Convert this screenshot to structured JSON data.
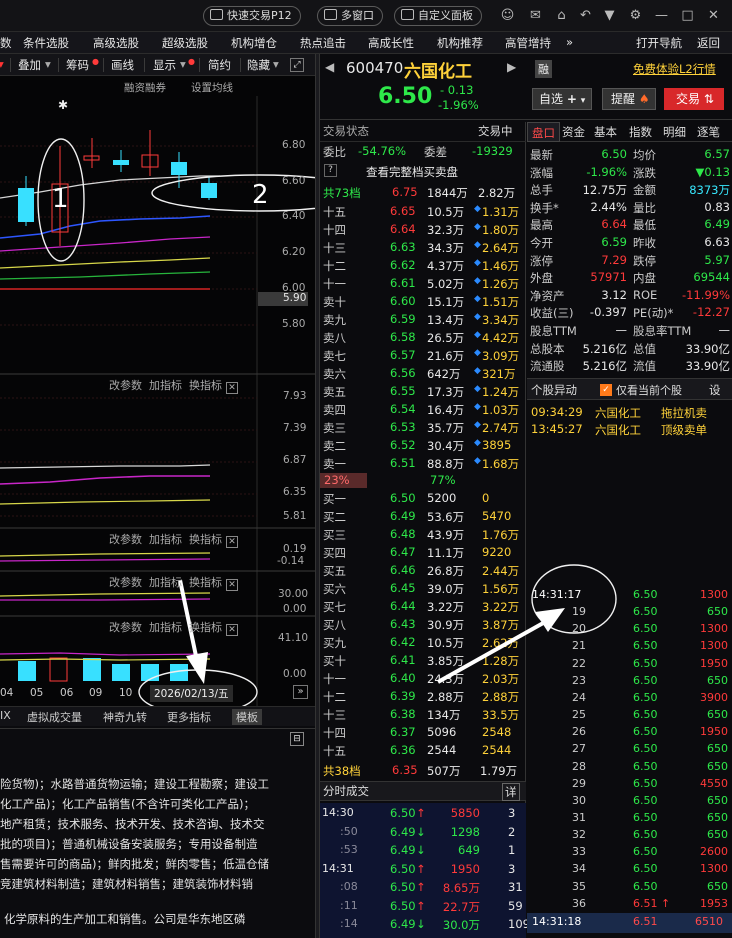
{
  "titlebar": {
    "quick_trade": "快速交易P12",
    "multi_window": "多窗口",
    "custom_panel": "自定义面板"
  },
  "menubar": [
    "数",
    "条件选股",
    "高级选股",
    "超级选股",
    "机构增仓",
    "热点追击",
    "高成长性",
    "机构推荐",
    "高管增持",
    "»",
    "打开导航",
    "返回"
  ],
  "toolbar": {
    "items": [
      "叠加",
      "筹码",
      "画线",
      "显示",
      "简约",
      "隐藏"
    ]
  },
  "chart": {
    "header": [
      "融资融券",
      "设置均线"
    ],
    "price_ticks": [
      "6.80",
      "6.60",
      "6.40",
      "6.20",
      "6.00",
      "5.80"
    ],
    "current_price_tag": "5.90",
    "annot1": "1",
    "annot2": "2",
    "sub_panels": [
      {
        "links": [
          "改参数",
          "加指标",
          "换指标"
        ],
        "ticks": [
          "7.93",
          "7.39",
          "6.87",
          "6.35",
          "5.81"
        ]
      },
      {
        "links": [
          "改参数",
          "加指标",
          "换指标"
        ],
        "ticks": [
          "0.19",
          "-0.14"
        ]
      },
      {
        "links": [
          "改参数",
          "加指标",
          "换指标"
        ],
        "ticks": [
          "30.00",
          "0.00"
        ]
      },
      {
        "links": [
          "改参数",
          "加指标",
          "换指标"
        ],
        "ticks": [
          "41.10",
          "0.00"
        ]
      }
    ],
    "dates": [
      "04",
      "05",
      "06",
      "09",
      "10"
    ],
    "date_cursor": "2026/02/13/五"
  },
  "bottomtabs": [
    "IX",
    "虚拟成交量",
    "神奇九转",
    "更多指标",
    "模板"
  ],
  "info_lines": [
    "险货物)；水路普通货物运输；建设工程勘察；建设工",
    "化工产品)；化工产品销售(不含许可类化工产品)；",
    "地产租赁；技术服务、技术开发、技术咨询、技术交",
    "批的项目)；普通机械设备安装服务；专用设备制造",
    "售需要许可的商品)；鲜肉批发；鲜肉零售；低温仓储",
    "竞建筑材料制造；建筑材料销售；建筑装饰材料销",
    "化学原料的生产加工和销售。公司是华东地区磷"
  ],
  "quote": {
    "code": "600470",
    "name": "六国化工",
    "rong": "融",
    "l2": "免费体验L2行情",
    "price": "6.50",
    "change": "- 0.13",
    "pct": "-1.96%",
    "btn_select": "自选",
    "btn_alert": "提醒",
    "btn_trade": "交易"
  },
  "book": {
    "tabs": [
      "交易状态",
      "交易中"
    ],
    "weibi_label": "委比",
    "weibi": "-54.76%",
    "weicha_label": "委差",
    "weicha": "-19329",
    "view_full": "查看完整档买卖盘",
    "sell_total": {
      "label": "共73档",
      "price": "6.75",
      "vol": "1844万",
      "amt": "2.82万"
    },
    "sells": [
      [
        "十五",
        "6.65",
        "10.5万",
        "1.31万"
      ],
      [
        "十四",
        "6.64",
        "32.3万",
        "1.80万"
      ],
      [
        "十三",
        "6.63",
        "34.3万",
        "2.64万"
      ],
      [
        "十二",
        "6.62",
        "4.37万",
        "1.46万"
      ],
      [
        "十一",
        "6.61",
        "5.02万",
        "1.26万"
      ],
      [
        "卖十",
        "6.60",
        "15.1万",
        "1.51万"
      ],
      [
        "卖九",
        "6.59",
        "13.4万",
        "3.34万"
      ],
      [
        "卖八",
        "6.58",
        "26.5万",
        "4.42万"
      ],
      [
        "卖七",
        "6.57",
        "21.6万",
        "3.09万"
      ],
      [
        "卖六",
        "6.56",
        "642万",
        "321万"
      ],
      [
        "卖五",
        "6.55",
        "17.3万",
        "1.24万"
      ],
      [
        "卖四",
        "6.54",
        "16.4万",
        "1.03万"
      ],
      [
        "卖三",
        "6.53",
        "35.7万",
        "2.74万"
      ],
      [
        "卖二",
        "6.52",
        "30.4万",
        "3895"
      ],
      [
        "卖一",
        "6.51",
        "88.8万",
        "1.68万"
      ]
    ],
    "ratio": {
      "buy": "23%",
      "sell": "77%",
      "buy_frac": 0.23
    },
    "buys": [
      [
        "买一",
        "6.50",
        "5200",
        "0"
      ],
      [
        "买二",
        "6.49",
        "53.6万",
        "5470"
      ],
      [
        "买三",
        "6.48",
        "43.9万",
        "1.76万"
      ],
      [
        "买四",
        "6.47",
        "11.1万",
        "9220"
      ],
      [
        "买五",
        "6.46",
        "26.8万",
        "2.44万"
      ],
      [
        "买六",
        "6.45",
        "39.0万",
        "1.56万"
      ],
      [
        "买七",
        "6.44",
        "3.22万",
        "3.22万"
      ],
      [
        "买八",
        "6.43",
        "30.9万",
        "3.87万"
      ],
      [
        "买九",
        "6.42",
        "10.5万",
        "2.62万"
      ],
      [
        "买十",
        "6.41",
        "3.85万",
        "1.28万"
      ],
      [
        "十一",
        "6.40",
        "24.3万",
        "2.03万"
      ],
      [
        "十二",
        "6.39",
        "2.88万",
        "2.88万"
      ],
      [
        "十三",
        "6.38",
        "134万",
        "33.5万"
      ],
      [
        "十四",
        "6.37",
        "5096",
        "2548"
      ],
      [
        "十五",
        "6.36",
        "2544",
        "2544"
      ]
    ],
    "buy_total": {
      "label": "共38档",
      "price": "6.35",
      "vol": "507万",
      "amt": "1.79万"
    },
    "fenshi_label": "分时成交",
    "fenshi_detail": "详",
    "fenshi": [
      [
        "14:30",
        "6.50",
        "5850",
        "3"
      ],
      [
        ":50",
        "6.49",
        "1298",
        "2"
      ],
      [
        ":53",
        "6.49",
        "649",
        "1"
      ],
      [
        "14:31",
        "6.50",
        "1950",
        "3"
      ],
      [
        ":08",
        "6.50",
        "8.65万",
        "31"
      ],
      [
        ":11",
        "6.50",
        "22.7万",
        "59"
      ],
      [
        ":14",
        "6.49",
        "30.0万",
        "109"
      ]
    ]
  },
  "panel": {
    "tabs": [
      "盘口",
      "资金",
      "基本",
      "指数",
      "明细",
      "逐笔"
    ],
    "rows": [
      [
        "最新",
        "6.50",
        "均价",
        "6.57"
      ],
      [
        "涨幅",
        "-1.96%",
        "涨跌",
        "▼0.13"
      ],
      [
        "总手",
        "12.75万",
        "金额",
        "8373万"
      ],
      [
        "换手*",
        "2.44%",
        "量比",
        "0.83"
      ],
      [
        "最高",
        "6.64",
        "最低",
        "6.49"
      ],
      [
        "今开",
        "6.59",
        "昨收",
        "6.63"
      ],
      [
        "涨停",
        "7.29",
        "跌停",
        "5.97"
      ],
      [
        "外盘",
        "57971",
        "内盘",
        "69544"
      ],
      [
        "净资产",
        "3.12",
        "ROE",
        "-11.99%"
      ],
      [
        "收益(三)",
        "-0.397",
        "PE(动)*",
        "-12.27"
      ],
      [
        "股息TTM",
        "—",
        "股息率TTM",
        "—"
      ],
      [
        "总股本",
        "5.216亿",
        "总值",
        "33.90亿"
      ],
      [
        "流通股",
        "5.216亿",
        "流值",
        "33.90亿"
      ]
    ],
    "alert_title": "个股异动",
    "alert_check": "仅看当前个股",
    "alert_set": "设",
    "alerts": [
      [
        "09:34:29",
        "六国化工",
        "拖拉机卖"
      ],
      [
        "13:45:27",
        "六国化工",
        "顶级卖单"
      ]
    ],
    "ticks": [
      [
        "14:31:17",
        "6.50",
        "1300"
      ],
      [
        "19",
        "6.50",
        "650"
      ],
      [
        "20",
        "6.50",
        "1300"
      ],
      [
        "21",
        "6.50",
        "1300"
      ],
      [
        "22",
        "6.50",
        "1950"
      ],
      [
        "23",
        "6.50",
        "650"
      ],
      [
        "24",
        "6.50",
        "3900"
      ],
      [
        "25",
        "6.50",
        "650"
      ],
      [
        "26",
        "6.50",
        "1950"
      ],
      [
        "27",
        "6.50",
        "650"
      ],
      [
        "28",
        "6.50",
        "650"
      ],
      [
        "29",
        "6.50",
        "4550"
      ],
      [
        "30",
        "6.50",
        "650"
      ],
      [
        "31",
        "6.50",
        "650"
      ],
      [
        "32",
        "6.50",
        "650"
      ],
      [
        "33",
        "6.50",
        "2600"
      ],
      [
        "34",
        "6.50",
        "1300"
      ],
      [
        "35",
        "6.50",
        "650"
      ],
      [
        "36",
        "6.51",
        "1953"
      ]
    ],
    "last_tick": [
      "14:31:18",
      "6.51",
      "6510"
    ]
  }
}
